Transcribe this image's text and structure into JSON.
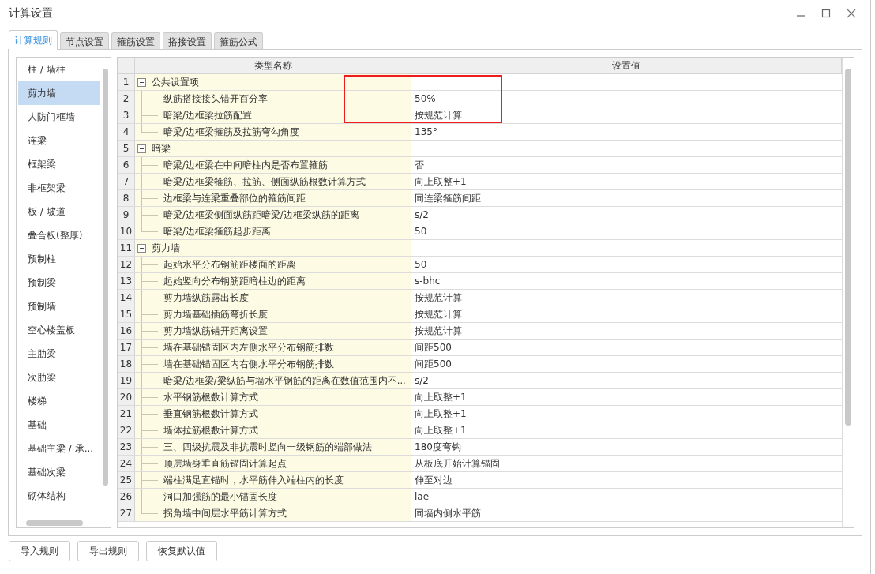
{
  "window": {
    "title": "计算设置"
  },
  "tabs": [
    {
      "label": "计算规则",
      "selected": true
    },
    {
      "label": "节点设置",
      "selected": false
    },
    {
      "label": "箍筋设置",
      "selected": false
    },
    {
      "label": "搭接设置",
      "selected": false
    },
    {
      "label": "箍筋公式",
      "selected": false
    }
  ],
  "sidebar": {
    "items": [
      {
        "label": "柱 / 墙柱",
        "selected": false
      },
      {
        "label": "剪力墙",
        "selected": true
      },
      {
        "label": "人防门框墙",
        "selected": false
      },
      {
        "label": "连梁",
        "selected": false
      },
      {
        "label": "框架梁",
        "selected": false
      },
      {
        "label": "非框架梁",
        "selected": false
      },
      {
        "label": "板 / 坡道",
        "selected": false
      },
      {
        "label": "叠合板(整厚)",
        "selected": false
      },
      {
        "label": "预制柱",
        "selected": false
      },
      {
        "label": "预制梁",
        "selected": false
      },
      {
        "label": "预制墙",
        "selected": false
      },
      {
        "label": "空心楼盖板",
        "selected": false
      },
      {
        "label": "主肋梁",
        "selected": false
      },
      {
        "label": "次肋梁",
        "selected": false
      },
      {
        "label": "楼梯",
        "selected": false
      },
      {
        "label": "基础",
        "selected": false
      },
      {
        "label": "基础主梁 / 承...",
        "selected": false
      },
      {
        "label": "基础次梁",
        "selected": false
      },
      {
        "label": "砌体结构",
        "selected": false
      }
    ]
  },
  "table": {
    "columns": [
      "类型名称",
      "设置值"
    ],
    "highlight": true,
    "rows": [
      {
        "no": "1",
        "name": "公共设置项",
        "expanded": true,
        "children": [
          {
            "no": "2",
            "name": "纵筋搭接接头错开百分率",
            "value": "50%"
          },
          {
            "no": "3",
            "name": "暗梁/边框梁拉筋配置",
            "value": "按规范计算"
          },
          {
            "no": "4",
            "name": "暗梁/边框梁箍筋及拉筋弯勾角度",
            "value": "135°"
          }
        ]
      },
      {
        "no": "5",
        "name": "暗梁",
        "expanded": true,
        "children": [
          {
            "no": "6",
            "name": "暗梁/边框梁在中间暗柱内是否布置箍筋",
            "value": "否"
          },
          {
            "no": "7",
            "name": "暗梁/边框梁箍筋、拉筋、侧面纵筋根数计算方式",
            "value": "向上取整+1"
          },
          {
            "no": "8",
            "name": "边框梁与连梁重叠部位的箍筋间距",
            "value": "同连梁箍筋间距"
          },
          {
            "no": "9",
            "name": "暗梁/边框梁侧面纵筋距暗梁/边框梁纵筋的距离",
            "value": "s/2"
          },
          {
            "no": "10",
            "name": "暗梁/边框梁箍筋起步距离",
            "value": "50"
          }
        ]
      },
      {
        "no": "11",
        "name": "剪力墙",
        "expanded": true,
        "children": [
          {
            "no": "12",
            "name": "起始水平分布钢筋距楼面的距离",
            "value": "50"
          },
          {
            "no": "13",
            "name": "起始竖向分布钢筋距暗柱边的距离",
            "value": "s-bhc"
          },
          {
            "no": "14",
            "name": "剪力墙纵筋露出长度",
            "value": "按规范计算"
          },
          {
            "no": "15",
            "name": "剪力墙基础插筋弯折长度",
            "value": "按规范计算"
          },
          {
            "no": "16",
            "name": "剪力墙纵筋错开距离设置",
            "value": "按规范计算"
          },
          {
            "no": "17",
            "name": "墙在基础锚固区内左侧水平分布钢筋排数",
            "value": "间距500"
          },
          {
            "no": "18",
            "name": "墙在基础锚固区内右侧水平分布钢筋排数",
            "value": "间距500"
          },
          {
            "no": "19",
            "name": "暗梁/边框梁/梁纵筋与墙水平钢筋的距离在数值范围内不...",
            "value": "s/2"
          },
          {
            "no": "20",
            "name": "水平钢筋根数计算方式",
            "value": "向上取整+1"
          },
          {
            "no": "21",
            "name": "垂直钢筋根数计算方式",
            "value": "向上取整+1"
          },
          {
            "no": "22",
            "name": "墙体拉筋根数计算方式",
            "value": "向上取整+1"
          },
          {
            "no": "23",
            "name": "三、四级抗震及非抗震时竖向一级钢筋的端部做法",
            "value": "180度弯钩"
          },
          {
            "no": "24",
            "name": "顶层墙身垂直筋锚固计算起点",
            "value": "从板底开始计算锚固"
          },
          {
            "no": "25",
            "name": "端柱满足直锚时，水平筋伸入端柱内的长度",
            "value": "伸至对边"
          },
          {
            "no": "26",
            "name": "洞口加强筋的最小锚固长度",
            "value": "lae"
          },
          {
            "no": "27",
            "name": "拐角墙中间层水平筋计算方式",
            "value": "同墙内侧水平筋"
          }
        ]
      }
    ]
  },
  "buttons": [
    "导入规则",
    "导出规则",
    "恢复默认值"
  ]
}
